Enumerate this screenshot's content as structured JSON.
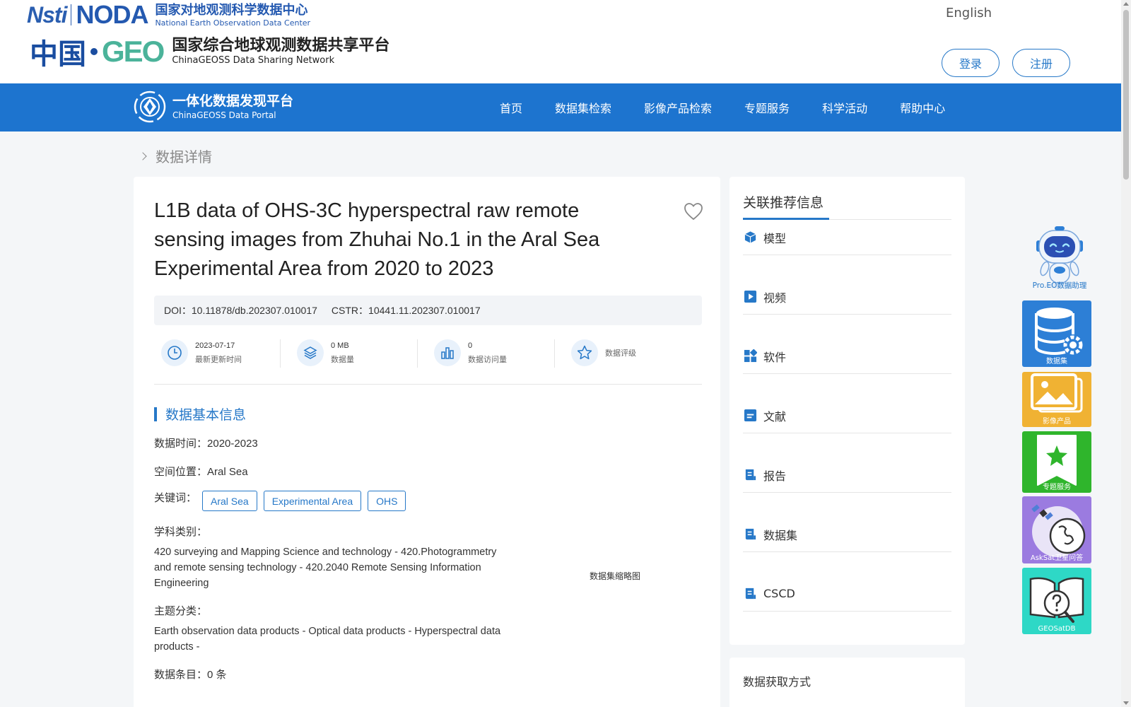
{
  "header": {
    "logo1_nsti": "Nsti",
    "logo1_noda": "NODA",
    "logo1_cn": "国家对地观测科学数据中心",
    "logo1_en": "National Earth Observation Data Center",
    "logo2_zhongguo": "中国",
    "logo2_geo": "GEO",
    "logo2_cn": "国家综合地球观测数据共享平台",
    "logo2_en": "ChinaGEOSS Data Sharing Network",
    "language": "English",
    "login": "登录",
    "register": "注册"
  },
  "nav": {
    "portal_cn": "一体化数据发现平台",
    "portal_en": "ChinaGEOSS Data Portal",
    "items": [
      "首页",
      "数据集检索",
      "影像产品检索",
      "专题服务",
      "科学活动",
      "帮助中心"
    ]
  },
  "breadcrumb": "数据详情",
  "dataset": {
    "title": "L1B data of OHS-3C hyperspectral raw remote sensing images from Zhuhai No.1 in the Aral Sea Experimental Area from 2020 to 2023",
    "doi_label": "DOI：",
    "doi": "10.11878/db.202307.010017",
    "cstr_label": "CSTR：",
    "cstr": "10441.11.202307.010017",
    "stats": [
      {
        "value": "2023-07-17",
        "label": "最新更新时间",
        "icon": "clock-icon"
      },
      {
        "value": "0 MB",
        "label": "数据量",
        "icon": "layers-icon"
      },
      {
        "value": "0",
        "label": "数据访问量",
        "icon": "bar-chart-icon"
      },
      {
        "value": "",
        "label": "数据评级",
        "icon": "star-icon"
      }
    ],
    "section_title": "数据基本信息",
    "time_label": "数据时间：",
    "time_value": "2020-2023",
    "location_label": "空间位置：",
    "location_value": "Aral Sea",
    "keywords_label": "关键词：",
    "keywords": [
      "Aral Sea",
      "Experimental Area",
      "OHS"
    ],
    "discipline_label": "学科类别：",
    "discipline_value": "420 surveying and Mapping Science and technology - 420.Photogrammetry and remote sensing technology - 420.2040 Remote Sensing Information Engineering",
    "theme_label": "主题分类：",
    "theme_value": "Earth observation data products - Optical data products - Hyperspectral data products -",
    "entries_label": "数据条目：",
    "entries_value": "0 条",
    "thumbnail_label": "数据集缩略图"
  },
  "side": {
    "title": "关联推荐信息",
    "items": [
      {
        "label": "模型",
        "icon": "cube-icon"
      },
      {
        "label": "视频",
        "icon": "play-icon"
      },
      {
        "label": "软件",
        "icon": "apps-icon"
      },
      {
        "label": "文献",
        "icon": "document-icon"
      },
      {
        "label": "报告",
        "icon": "report-icon"
      },
      {
        "label": "数据集",
        "icon": "dataset-icon"
      },
      {
        "label": "CSCD",
        "icon": "cscd-icon"
      }
    ],
    "access_title": "数据获取方式"
  },
  "float_tools": {
    "robot_label": "Pro.EO数据助理",
    "dataset": "数据集",
    "image_products": "影像产品",
    "topic_service": "专题服务",
    "asksat": "AskSat卫星问答",
    "geosatdb": "GEOSatDB"
  },
  "colors": {
    "primary": "#1d74cf",
    "accent": "#2678c8",
    "tool_dataset": "#2d7fd6",
    "tool_image": "#f0b233",
    "tool_topic": "#2fb52c",
    "tool_asksat": "#9b7be0",
    "tool_geosatdb": "#2ed8c6"
  }
}
